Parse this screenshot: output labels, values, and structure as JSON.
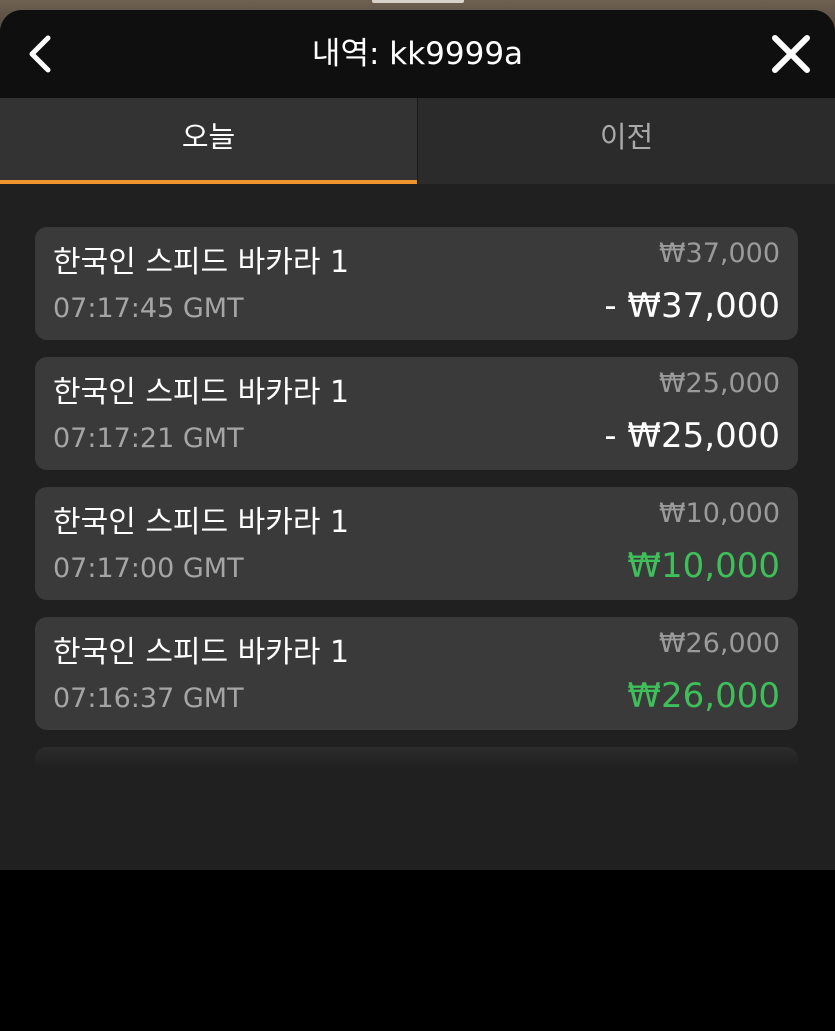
{
  "header": {
    "title": "내역: kk9999a",
    "back_icon": "chevron-left-icon",
    "close_icon": "close-icon"
  },
  "tabs": [
    {
      "label": "오늘",
      "active": true
    },
    {
      "label": "이전",
      "active": false
    }
  ],
  "items": [
    {
      "game": "한국인 스피드 바카라 1",
      "time": "07:17:45 GMT",
      "bet": "₩37,000",
      "result": "- ₩37,000",
      "outcome": "loss"
    },
    {
      "game": "한국인 스피드 바카라 1",
      "time": "07:17:21 GMT",
      "bet": "₩25,000",
      "result": "- ₩25,000",
      "outcome": "loss"
    },
    {
      "game": "한국인 스피드 바카라 1",
      "time": "07:17:00 GMT",
      "bet": "₩10,000",
      "result": "₩10,000",
      "outcome": "win"
    },
    {
      "game": "한국인 스피드 바카라 1",
      "time": "07:16:37 GMT",
      "bet": "₩26,000",
      "result": "₩26,000",
      "outcome": "win"
    }
  ],
  "colors": {
    "accent": "#f0952c",
    "win": "#3fbf5a",
    "loss": "#ffffff"
  }
}
